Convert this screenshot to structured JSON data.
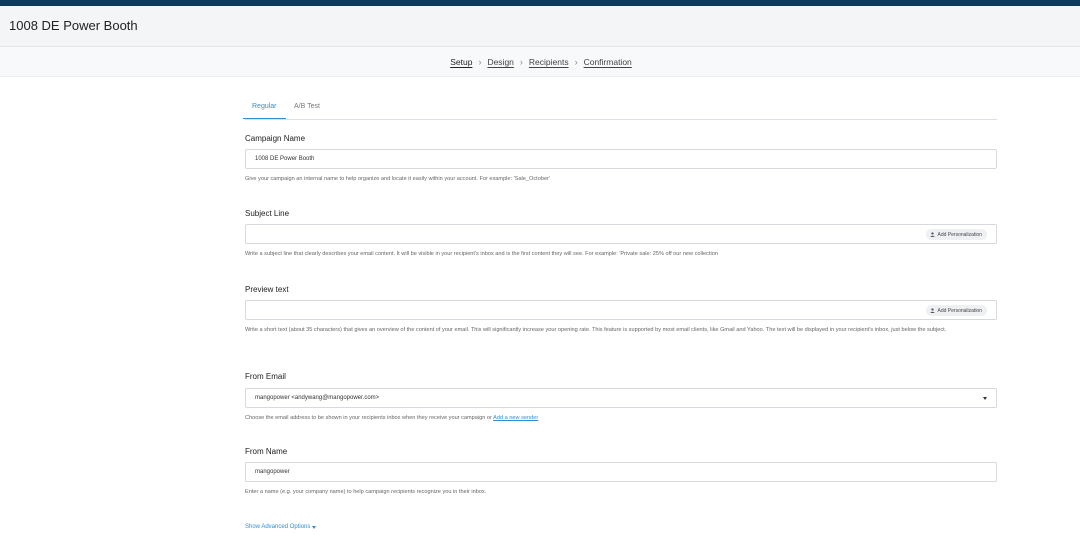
{
  "header": {
    "title": "1008 DE Power Booth"
  },
  "steps": {
    "items": [
      {
        "label": "Setup"
      },
      {
        "label": "Design"
      },
      {
        "label": "Recipients"
      },
      {
        "label": "Confirmation"
      }
    ],
    "separator": "›"
  },
  "tabs": {
    "regular": "Regular",
    "ab_test": "A/B Test"
  },
  "campaign_name": {
    "label": "Campaign Name",
    "value": "1008 DE Power Booth",
    "help": "Give your campaign an internal name to help organize and locate it easily within your account. For example: 'Sale_October'"
  },
  "subject_line": {
    "label": "Subject Line",
    "value": "",
    "personalization": "Add Personalization",
    "help": "Write a subject line that clearly describes your email content. It will be visible in your recipient's inbox and is the first content they will see. For example: 'Private sale: 25% off our new collection"
  },
  "preview_text": {
    "label": "Preview text",
    "value": "",
    "personalization": "Add Personalization",
    "help": "Write a short text (about 35 characters) that gives an overview of the content of your email. This will significantly increase your opening rate. This feature is supported by most email clients, like Gmail and Yahoo. The text will be displayed in your recipient's inbox, just below the subject."
  },
  "from_email": {
    "label": "From Email",
    "value": "mangopower <andywang@mangopower.com>",
    "help_prefix": "Choose the email address to be shown in your recipients inbox when they receive your campaign or ",
    "help_link": "Add a new sender"
  },
  "from_name": {
    "label": "From Name",
    "value": "mangopower",
    "help": "Enter a name (e.g. your company name) to help campaign recipients recognize you in their inbox."
  },
  "advanced": {
    "label": "Show Advanced Options"
  },
  "colors": {
    "accent": "#2f8fd6",
    "topbar": "#0b3a5c"
  }
}
